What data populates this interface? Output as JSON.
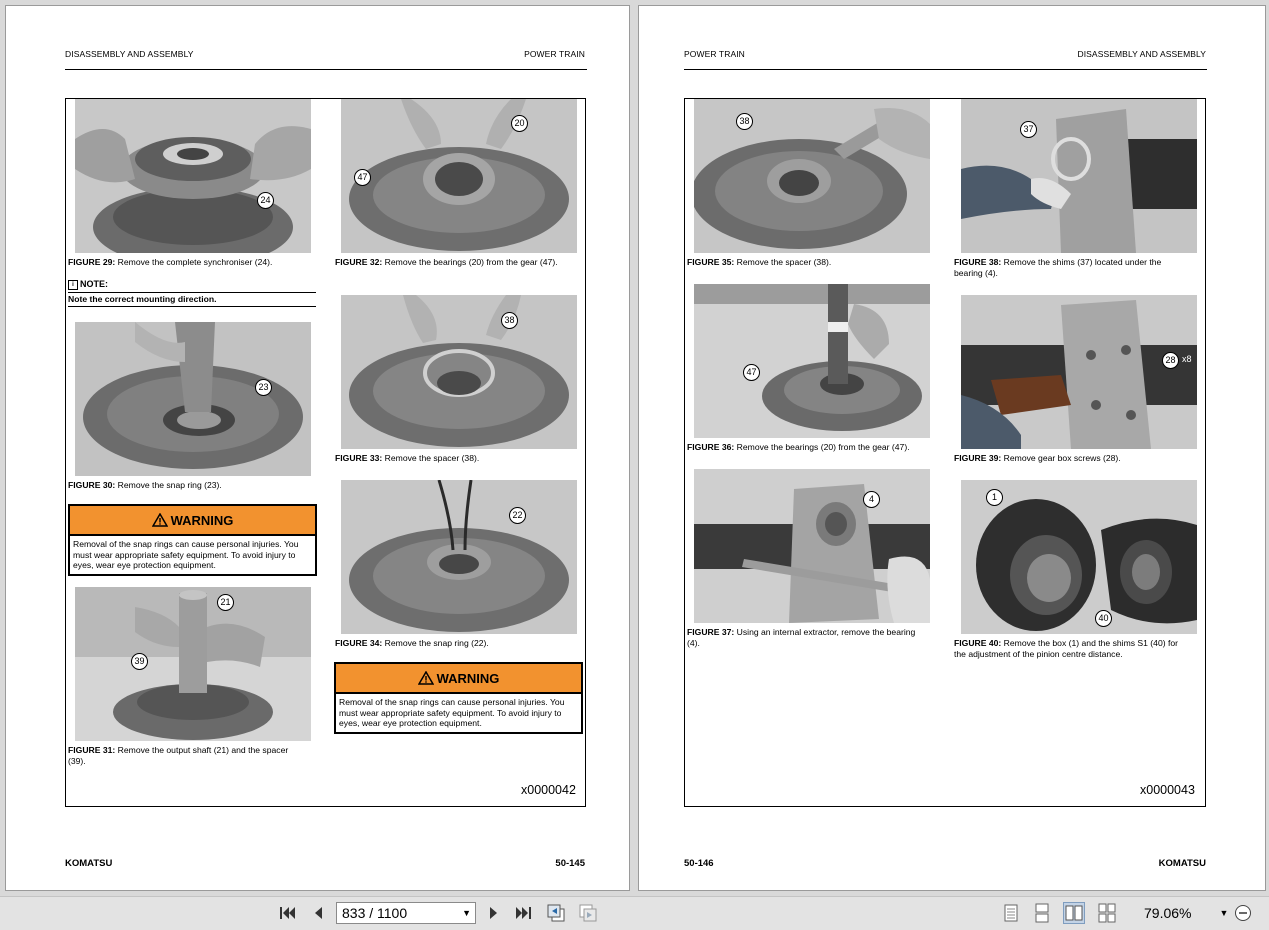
{
  "left_page": {
    "header_left": "DISASSEMBLY AND ASSEMBLY",
    "header_right": "POWER TRAIN",
    "footer_left": "KOMATSU",
    "footer_right": "50-145",
    "figure_code": "x0000042",
    "figures": {
      "fig29": {
        "label": "FIGURE 29:",
        "text": " Remove the complete synchroniser (24).",
        "callouts": [
          "24"
        ]
      },
      "fig30": {
        "label": "FIGURE 30:",
        "text": " Remove the snap ring (23).",
        "callouts": [
          "23"
        ]
      },
      "fig31": {
        "label": "FIGURE 31:",
        "text": " Remove the output shaft (21) and the spacer (39).",
        "callouts": [
          "21",
          "39"
        ]
      },
      "fig32": {
        "label": "FIGURE 32:",
        "text": " Remove the bearings (20) from the gear (47).",
        "callouts": [
          "47",
          "20"
        ]
      },
      "fig33": {
        "label": "FIGURE 33:",
        "text": " Remove the spacer (38).",
        "callouts": [
          "38"
        ]
      },
      "fig34": {
        "label": "FIGURE 34:",
        "text": " Remove the snap ring (22).",
        "callouts": [
          "22"
        ]
      }
    },
    "note": {
      "title": "NOTE:",
      "text": "Note the correct mounting direction."
    },
    "warning1": {
      "title": "WARNING",
      "text": "Removal of the snap rings can cause personal injuries. You must wear appropriate safety equipment. To avoid injury to eyes, wear eye protection equipment."
    },
    "warning2": {
      "title": "WARNING",
      "text": "Removal of the snap rings can cause personal injuries. You must wear appropriate safety equipment. To avoid injury to eyes, wear eye protection equipment."
    }
  },
  "right_page": {
    "header_left": "POWER TRAIN",
    "header_right": "DISASSEMBLY AND ASSEMBLY",
    "footer_left": "50-146",
    "footer_right": "KOMATSU",
    "figure_code": "x0000043",
    "figures": {
      "fig35": {
        "label": "FIGURE 35:",
        "text": " Remove the spacer (38).",
        "callouts": [
          "38"
        ]
      },
      "fig36": {
        "label": "FIGURE 36:",
        "text": " Remove the bearings (20) from the gear (47).",
        "callouts": [
          "47"
        ]
      },
      "fig37": {
        "label": "FIGURE 37:",
        "text": " Using an internal extractor, remove the bearing (4).",
        "callouts": [
          "4"
        ]
      },
      "fig38": {
        "label": "FIGURE 38:",
        "text": " Remove the shims (37) located under the bearing (4).",
        "callouts": [
          "37"
        ]
      },
      "fig39": {
        "label": "FIGURE 39:",
        "text": " Remove gear box screws (28).",
        "callouts": [
          "28"
        ],
        "suffix": "x8"
      },
      "fig40": {
        "label": "FIGURE 40:",
        "text": " Remove the box (1) and the shims S1 (40) for the adjustment of the pinion centre distance.",
        "callouts": [
          "1",
          "40"
        ]
      }
    }
  },
  "toolbar": {
    "page_value": "833 / 1100",
    "zoom": "79.06%",
    "icons": [
      "first-page-icon",
      "prev-page-icon",
      "next-page-icon",
      "last-page-icon",
      "go-back-icon",
      "go-forward-icon",
      "single-page-icon",
      "continuous-icon",
      "two-page-icon",
      "two-page-continuous-icon",
      "zoom-dropdown-icon",
      "zoom-out-icon"
    ]
  },
  "colors": {
    "warning_bar": "#f2922f",
    "page": "#ffffff",
    "background": "#d9d9d9"
  }
}
